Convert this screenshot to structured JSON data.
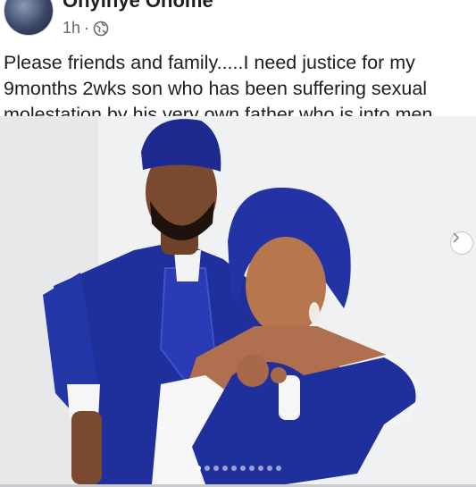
{
  "post": {
    "author": "Onyinye Onome",
    "time": "1h",
    "separator": "·",
    "privacy_icon": "globe-icon",
    "text": "Please friends and family.....I need justice for my 9months 2wks son who has been suffering sexual molestation by his very own father who is into men"
  },
  "carousel": {
    "next_icon": "chevron-right-icon",
    "slide_count": 10,
    "active_index": 0
  },
  "colors": {
    "royal_blue": "#1f2f9c",
    "cap_blue": "#1d2a8f"
  }
}
